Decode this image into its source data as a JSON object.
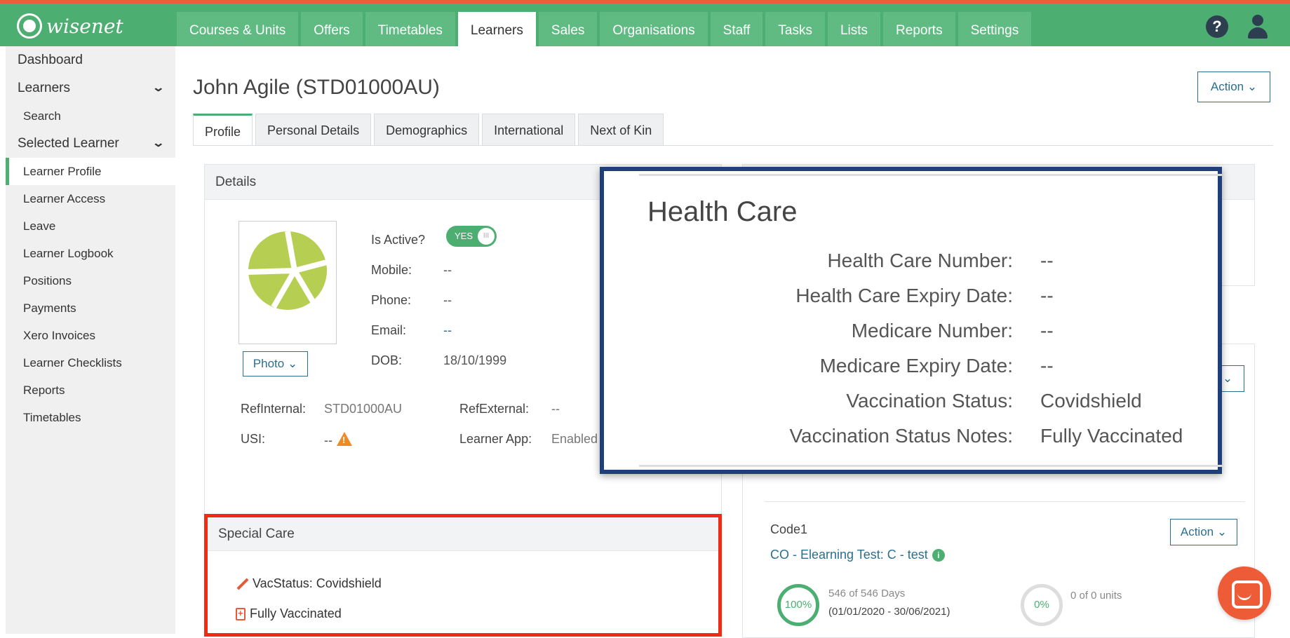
{
  "brand": {
    "name": "wisenet"
  },
  "nav": {
    "tabs": [
      "Courses & Units",
      "Offers",
      "Timetables",
      "Learners",
      "Sales",
      "Organisations",
      "Staff",
      "Tasks",
      "Lists",
      "Reports",
      "Settings"
    ],
    "active": "Learners",
    "help_glyph": "?"
  },
  "sidebar": {
    "dashboard": "Dashboard",
    "learners": "Learners",
    "search": "Search",
    "selected_learner": "Selected Learner",
    "items": [
      "Learner Profile",
      "Learner Access",
      "Leave",
      "Learner Logbook",
      "Positions",
      "Payments",
      "Xero Invoices",
      "Learner Checklists",
      "Reports",
      "Timetables"
    ],
    "active": "Learner Profile"
  },
  "page": {
    "title": "John Agile (STD01000AU)",
    "action_label": "Action",
    "tabs": [
      "Profile",
      "Personal Details",
      "Demographics",
      "International",
      "Next of Kin"
    ],
    "active_tab": "Profile"
  },
  "details": {
    "heading": "Details",
    "photo_btn": "Photo",
    "is_active_label": "Is Active?",
    "toggle_yes": "YES",
    "toggle_knob": "III",
    "mobile_label": "Mobile:",
    "mobile": "--",
    "phone_label": "Phone:",
    "phone": "--",
    "email_label": "Email:",
    "email": "--",
    "dob_label": "DOB:",
    "dob": "18/10/1999",
    "refinternal_label": "RefInternal:",
    "refinternal": "STD01000AU",
    "refexternal_label": "RefExternal:",
    "refexternal": "--",
    "usi_label": "USI:",
    "usi": "--",
    "learner_app_label": "Learner App:",
    "learner_app": "Enabled",
    "warn_glyph": "!"
  },
  "special_care": {
    "heading": "Special Care",
    "vac_status": "VacStatus: Covidshield",
    "vac_note": "Fully Vaccinated"
  },
  "health_care": {
    "title": "Health Care",
    "rows": [
      {
        "label": "Health Care Number:",
        "value": "--"
      },
      {
        "label": "Health Care Expiry Date:",
        "value": "--"
      },
      {
        "label": "Medicare Number:",
        "value": "--"
      },
      {
        "label": "Medicare Expiry Date:",
        "value": "--"
      },
      {
        "label": "Vaccination Status:",
        "value": "Covidshield"
      },
      {
        "label": "Vaccination Status Notes:",
        "value": "Fully Vaccinated"
      }
    ]
  },
  "enrolment": {
    "code": "Code1",
    "course_link": "CO - Elearning Test: C - test",
    "info_glyph": "i",
    "action_label": "Action",
    "days_pct": "100%",
    "days_text": "546 of 546 Days",
    "date_range": "(01/01/2020 - 30/06/2021)",
    "units_pct": "0%",
    "units_text": "0 of 0 units"
  },
  "colors": {
    "brand": "#4cae71",
    "accent": "#e8603a",
    "popup_border": "#1f3f7a",
    "highlight": "#ef2b14",
    "link": "#2a6f8e"
  },
  "icons": [
    "help-icon",
    "user-icon",
    "chevron-down-icon",
    "warning-icon",
    "pencil-icon",
    "clipboard-icon",
    "info-icon",
    "chat-icon"
  ]
}
